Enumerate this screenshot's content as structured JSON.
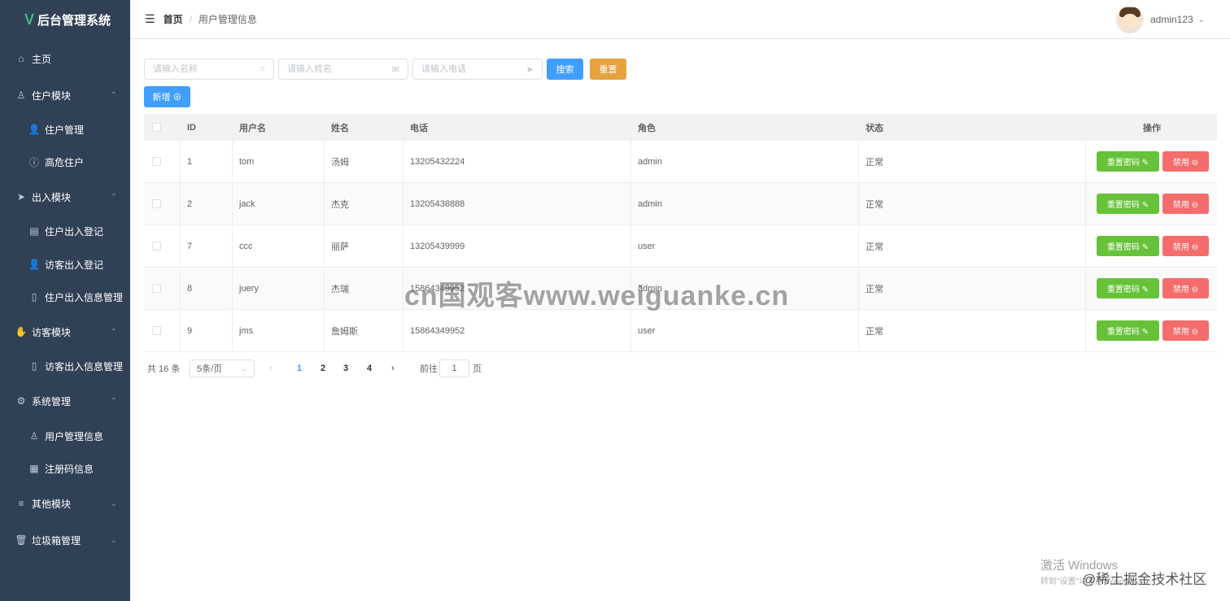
{
  "sidebar": {
    "logo_mark": "V",
    "title": "后台管理系统",
    "items": [
      {
        "label": "主页",
        "icon": "home-icon",
        "level": "top",
        "arrow": ""
      },
      {
        "label": "住户模块",
        "icon": "user-icon",
        "level": "top",
        "arrow": "⌃"
      },
      {
        "label": "住户管理",
        "icon": "person-icon",
        "level": "sub",
        "arrow": ""
      },
      {
        "label": "高危住户",
        "icon": "info-circle-icon",
        "level": "sub",
        "arrow": ""
      },
      {
        "label": "出入模块",
        "icon": "paper-plane-icon",
        "level": "top",
        "arrow": "⌃"
      },
      {
        "label": "住户出入登记",
        "icon": "notebook-icon",
        "level": "sub",
        "arrow": ""
      },
      {
        "label": "访客出入登记",
        "icon": "person-icon",
        "level": "sub",
        "arrow": ""
      },
      {
        "label": "住户出入信息管理",
        "icon": "document-icon",
        "level": "sub",
        "arrow": ""
      },
      {
        "label": "访客模块",
        "icon": "hand-icon",
        "level": "top",
        "arrow": "⌃"
      },
      {
        "label": "访客出入信息管理",
        "icon": "document-icon",
        "level": "sub",
        "arrow": ""
      },
      {
        "label": "系统管理",
        "icon": "gear-icon",
        "level": "top",
        "arrow": "⌃"
      },
      {
        "label": "用户管理信息",
        "icon": "user-icon",
        "level": "sub",
        "arrow": ""
      },
      {
        "label": "注册码信息",
        "icon": "grid-icon",
        "level": "sub",
        "arrow": ""
      },
      {
        "label": "其他模块",
        "icon": "menu-icon",
        "level": "top",
        "arrow": "⌄"
      },
      {
        "label": "垃圾箱管理",
        "icon": "trash-icon",
        "level": "top",
        "arrow": "⌄"
      }
    ]
  },
  "header": {
    "breadcrumb_home": "首页",
    "breadcrumb_sep": "/",
    "breadcrumb_current": "用户管理信息",
    "username": "admin123"
  },
  "search": {
    "name_placeholder": "请输入名称",
    "realname_placeholder": "请输入姓名",
    "phone_placeholder": "请输入电话",
    "search_label": "搜索",
    "reset_label": "重置",
    "add_label": "新增 ⊕"
  },
  "table": {
    "columns": [
      "ID",
      "用户名",
      "姓名",
      "电话",
      "角色",
      "状态",
      "操作"
    ],
    "rows": [
      {
        "id": "1",
        "username": "tom",
        "name": "汤姆",
        "phone": "13205432224",
        "role": "admin",
        "status": "正常"
      },
      {
        "id": "2",
        "username": "jack",
        "name": "杰克",
        "phone": "13205438888",
        "role": "admin",
        "status": "正常"
      },
      {
        "id": "7",
        "username": "ccc",
        "name": "丽萨",
        "phone": "13205439999",
        "role": "user",
        "status": "正常"
      },
      {
        "id": "8",
        "username": "juery",
        "name": "杰瑞",
        "phone": "15864349952",
        "role": "admin",
        "status": "正常"
      },
      {
        "id": "9",
        "username": "jms",
        "name": "詹姆斯",
        "phone": "15864349952",
        "role": "user",
        "status": "正常"
      }
    ],
    "reset_pwd_label": "重置密码 ✎",
    "disable_label": "禁用 ⊖"
  },
  "pagination": {
    "total_text": "共 16 条",
    "page_size": "5条/页",
    "pages": [
      "1",
      "2",
      "3",
      "4"
    ],
    "current_page": "1",
    "goto_prefix": "前往",
    "goto_value": "1",
    "goto_suffix": "页"
  },
  "watermarks": {
    "site": "cn国观客www.weiguanke.cn",
    "windows_title": "激活 Windows",
    "windows_sub": "转到\"设置\"以激活 Windows。",
    "juejin": "@稀土掘金技术社区"
  },
  "colors": {
    "sidebar_bg": "#304156",
    "primary": "#409eff",
    "warning": "#e6a23c",
    "success": "#67c23a",
    "danger": "#f56c6c"
  }
}
